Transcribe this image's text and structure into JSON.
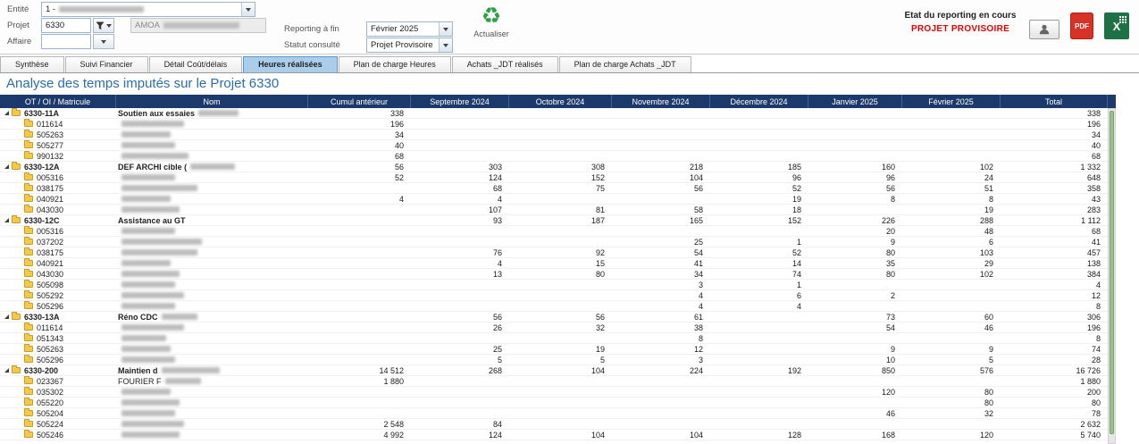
{
  "topbar": {
    "fields": {
      "entite_label": "Entité",
      "entite_value": "1 -",
      "projet_label": "Projet",
      "projet_value": "6330",
      "amoa_prefix": "AMOA",
      "affaire_label": "Affaire"
    },
    "reporting": {
      "reporting_label": "Reporting à fin",
      "reporting_value": "Février 2025",
      "statut_label": "Statut consulté",
      "statut_value": "Projet Provisoire"
    },
    "actualiser_label": "Actualiser",
    "status": {
      "label": "Etat du reporting en cours",
      "value": "PROJET PROVISOIRE"
    },
    "icons": {
      "pdf_label": "PDF",
      "excel_label": "X",
      "refresh_glyph": "♻"
    }
  },
  "tabs": [
    {
      "label": "Synthèse",
      "active": false
    },
    {
      "label": "Suivi Financier",
      "active": false
    },
    {
      "label": "Détail Coût/délais",
      "active": false
    },
    {
      "label": "Heures réalisées",
      "active": true
    },
    {
      "label": "Plan de charge Heures",
      "active": false
    },
    {
      "label": "Achats _JDT réalisés",
      "active": false
    },
    {
      "label": "Plan de charge Achats _JDT",
      "active": false
    }
  ],
  "title": "Analyse des temps imputés sur le Projet 6330",
  "table": {
    "columns": [
      "OT / OI / Matricule",
      "Nom",
      "Cumul antérieur",
      "Septembre 2024",
      "Octobre 2024",
      "Novembre 2024",
      "Décembre 2024",
      "Janvier 2025",
      "Février 2025",
      "Total"
    ],
    "rows": [
      {
        "type": "group",
        "code": "6330-11A",
        "name": "Soutien aux essaies",
        "blur": 45,
        "values": [
          "338",
          "",
          "",
          "",
          "",
          "",
          "",
          "338"
        ]
      },
      {
        "type": "child",
        "code": "011614",
        "name": "",
        "blur": 70,
        "values": [
          "196",
          "",
          "",
          "",
          "",
          "",
          "",
          "196"
        ]
      },
      {
        "type": "child",
        "code": "505263",
        "name": "",
        "blur": 55,
        "values": [
          "34",
          "",
          "",
          "",
          "",
          "",
          "",
          "34"
        ]
      },
      {
        "type": "child",
        "code": "505277",
        "name": "",
        "blur": 60,
        "values": [
          "40",
          "",
          "",
          "",
          "",
          "",
          "",
          "40"
        ]
      },
      {
        "type": "child",
        "code": "990132",
        "name": "",
        "blur": 75,
        "values": [
          "68",
          "",
          "",
          "",
          "",
          "",
          "",
          "68"
        ]
      },
      {
        "type": "group",
        "code": "6330-12A",
        "name": "DEF ARCHI cible (",
        "blur": 50,
        "values": [
          "56",
          "303",
          "308",
          "218",
          "185",
          "160",
          "102",
          "1 332"
        ]
      },
      {
        "type": "child",
        "code": "005316",
        "name": "",
        "blur": 60,
        "values": [
          "52",
          "124",
          "152",
          "104",
          "96",
          "96",
          "24",
          "648"
        ]
      },
      {
        "type": "child",
        "code": "038175",
        "name": "",
        "blur": 85,
        "values": [
          "",
          "68",
          "75",
          "56",
          "52",
          "56",
          "51",
          "358"
        ]
      },
      {
        "type": "child",
        "code": "040921",
        "name": "",
        "blur": 55,
        "values": [
          "4",
          "4",
          "",
          "",
          "19",
          "8",
          "8",
          "43"
        ]
      },
      {
        "type": "child",
        "code": "043030",
        "name": "",
        "blur": 65,
        "values": [
          "",
          "107",
          "81",
          "58",
          "18",
          "",
          "19",
          "283"
        ]
      },
      {
        "type": "group",
        "code": "6330-12C",
        "name": "Assistance au GT",
        "blur": 0,
        "values": [
          "",
          "93",
          "187",
          "165",
          "152",
          "226",
          "288",
          "1 112"
        ]
      },
      {
        "type": "child",
        "code": "005316",
        "name": "",
        "blur": 60,
        "values": [
          "",
          "",
          "",
          "",
          "",
          "20",
          "48",
          "68"
        ]
      },
      {
        "type": "child",
        "code": "037202",
        "name": "",
        "blur": 90,
        "values": [
          "",
          "",
          "",
          "25",
          "1",
          "9",
          "6",
          "41"
        ]
      },
      {
        "type": "child",
        "code": "038175",
        "name": "",
        "blur": 85,
        "values": [
          "",
          "76",
          "92",
          "54",
          "52",
          "80",
          "103",
          "457"
        ]
      },
      {
        "type": "child",
        "code": "040921",
        "name": "",
        "blur": 55,
        "values": [
          "",
          "4",
          "15",
          "41",
          "14",
          "35",
          "29",
          "138"
        ]
      },
      {
        "type": "child",
        "code": "043030",
        "name": "",
        "blur": 65,
        "values": [
          "",
          "13",
          "80",
          "34",
          "74",
          "80",
          "102",
          "384"
        ]
      },
      {
        "type": "child",
        "code": "505098",
        "name": "",
        "blur": 60,
        "values": [
          "",
          "",
          "",
          "3",
          "1",
          "",
          "",
          "4"
        ]
      },
      {
        "type": "child",
        "code": "505292",
        "name": "",
        "blur": 70,
        "values": [
          "",
          "",
          "",
          "4",
          "6",
          "2",
          "",
          "12"
        ]
      },
      {
        "type": "child",
        "code": "505296",
        "name": "",
        "blur": 60,
        "values": [
          "",
          "",
          "",
          "4",
          "4",
          "",
          "",
          "8"
        ]
      },
      {
        "type": "group",
        "code": "6330-13A",
        "name": "Réno CDC",
        "blur": 40,
        "values": [
          "",
          "56",
          "56",
          "61",
          "",
          "73",
          "60",
          "306"
        ]
      },
      {
        "type": "child",
        "code": "011614",
        "name": "",
        "blur": 70,
        "values": [
          "",
          "26",
          "32",
          "38",
          "",
          "54",
          "46",
          "196"
        ]
      },
      {
        "type": "child",
        "code": "051343",
        "name": "",
        "blur": 50,
        "values": [
          "",
          "",
          "",
          "8",
          "",
          "",
          "",
          "8"
        ]
      },
      {
        "type": "child",
        "code": "505263",
        "name": "",
        "blur": 55,
        "values": [
          "",
          "25",
          "19",
          "12",
          "",
          "9",
          "9",
          "74"
        ]
      },
      {
        "type": "child",
        "code": "505296",
        "name": "",
        "blur": 60,
        "values": [
          "",
          "5",
          "5",
          "3",
          "",
          "10",
          "5",
          "28"
        ]
      },
      {
        "type": "group",
        "code": "6330-200",
        "name": "Maintien d",
        "blur": 65,
        "values": [
          "14 512",
          "268",
          "104",
          "224",
          "192",
          "850",
          "576",
          "16 726"
        ]
      },
      {
        "type": "child",
        "code": "023367",
        "name": "FOURIER F",
        "blur": 40,
        "values": [
          "1 880",
          "",
          "",
          "",
          "",
          "",
          "",
          "1 880"
        ]
      },
      {
        "type": "child",
        "code": "035302",
        "name": "",
        "blur": 55,
        "values": [
          "",
          "",
          "",
          "",
          "",
          "120",
          "80",
          "200"
        ]
      },
      {
        "type": "child",
        "code": "055220",
        "name": "",
        "blur": 65,
        "values": [
          "",
          "",
          "",
          "",
          "",
          "",
          "80",
          "80"
        ]
      },
      {
        "type": "child",
        "code": "505204",
        "name": "",
        "blur": 60,
        "values": [
          "",
          "",
          "",
          "",
          "",
          "46",
          "32",
          "78"
        ]
      },
      {
        "type": "child",
        "code": "505224",
        "name": "",
        "blur": 70,
        "values": [
          "2 548",
          "84",
          "",
          "",
          "",
          "",
          "",
          "2 632"
        ]
      },
      {
        "type": "child",
        "code": "505246",
        "name": "",
        "blur": 65,
        "values": [
          "4 992",
          "124",
          "104",
          "104",
          "128",
          "168",
          "120",
          "5 740"
        ]
      }
    ]
  },
  "colors": {
    "header_bg": "#1b3a6b",
    "active_tab": "#a9cdeb",
    "title_blue": "#2a6dad",
    "status_red": "#e60000",
    "refresh_green": "#2f9e44",
    "folder_yellow": "#f7c847",
    "scroll_thumb_green": "#9cbf8e"
  }
}
